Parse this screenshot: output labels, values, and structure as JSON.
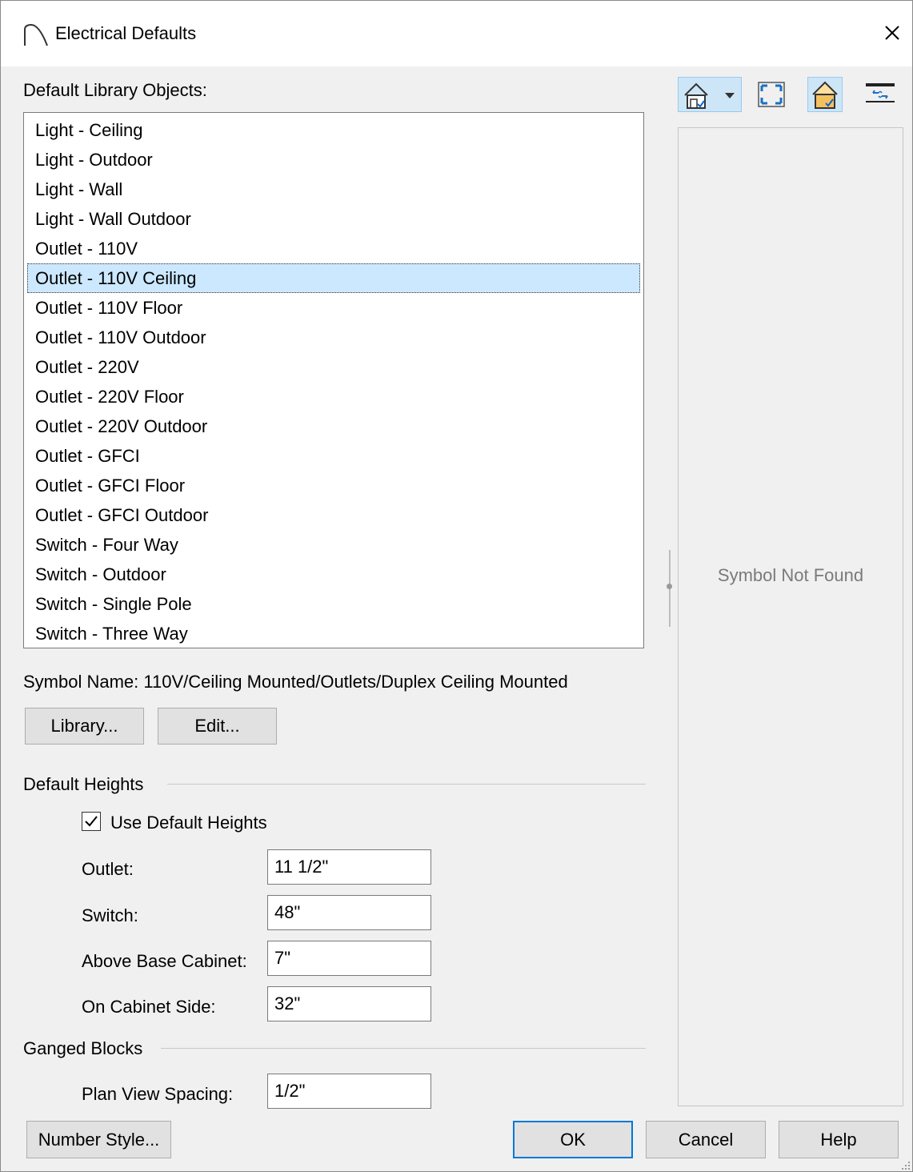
{
  "window": {
    "title": "Electrical Defaults"
  },
  "library": {
    "heading": "Default Library Objects:",
    "items": [
      "Light - Ceiling",
      "Light - Outdoor",
      "Light - Wall",
      "Light - Wall Outdoor",
      "Outlet - 110V",
      "Outlet - 110V Ceiling",
      "Outlet - 110V Floor",
      "Outlet - 110V Outdoor",
      "Outlet - 220V",
      "Outlet - 220V Floor",
      "Outlet - 220V Outdoor",
      "Outlet - GFCI",
      "Outlet - GFCI Floor",
      "Outlet - GFCI Outdoor",
      "Switch - Four Way",
      "Switch - Outdoor",
      "Switch - Single Pole",
      "Switch - Three Way"
    ],
    "selected_item": "Outlet - 110V Ceiling",
    "symbol_name": "Symbol Name: 110V/Ceiling Mounted/Outlets/Duplex Ceiling Mounted",
    "library_button": "Library...",
    "edit_button": "Edit..."
  },
  "default_heights": {
    "heading": "Default Heights",
    "use_defaults_label": "Use Default Heights",
    "use_defaults_checked": true,
    "outlet_label": "Outlet:",
    "outlet_value": "11 1/2\"",
    "switch_label": "Switch:",
    "switch_value": "48\"",
    "above_base_label": "Above Base Cabinet:",
    "above_base_value": "7\"",
    "cabinet_side_label": "On Cabinet Side:",
    "cabinet_side_value": "32\""
  },
  "ganged_blocks": {
    "heading": "Ganged Blocks",
    "spacing_label": "Plan View Spacing:",
    "spacing_value": "1/2\""
  },
  "preview": {
    "message": "Symbol Not Found",
    "toolbar": [
      "view-options-icon",
      "fill-window-icon",
      "show-in-room-icon",
      "rotate-plan-icon"
    ]
  },
  "footer": {
    "number_style": "Number Style...",
    "ok": "OK",
    "cancel": "Cancel",
    "help": "Help"
  },
  "colors": {
    "accent": "#0078d7",
    "selection": "#cce8ff",
    "background": "#f0f0f0"
  }
}
